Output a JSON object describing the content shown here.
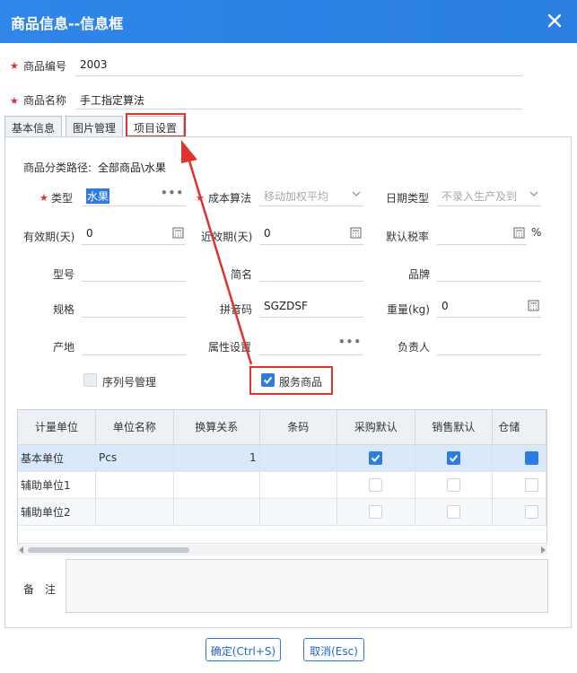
{
  "window": {
    "title": "商品信息--信息框",
    "accent": "#2f86e8"
  },
  "header": {
    "code_label": "商品编号",
    "code_value": "2003",
    "name_label": "商品名称",
    "name_value": "手工指定算法"
  },
  "tabs": [
    "基本信息",
    "图片管理",
    "项目设置"
  ],
  "form": {
    "category_path_label": "商品分类路径:",
    "category_path_value": "全部商品\\水果",
    "type_label": "类型",
    "type_value": "水果",
    "cost_method_label": "成本算法",
    "cost_method_value": "移动加权平均",
    "date_type_label": "日期类型",
    "date_type_value": "不录入生产及到期",
    "shelf_life_label": "有效期(天)",
    "shelf_life_value": "0",
    "near_expiry_label": "近效期(天)",
    "near_expiry_value": "0",
    "tax_label": "默认税率",
    "tax_unit": "%",
    "model_label": "型号",
    "short_name_label": "简名",
    "brand_label": "品牌",
    "spec_label": "规格",
    "pinyin_label": "拼音码",
    "pinyin_value": "SGZDSF",
    "weight_label": "重量(kg)",
    "weight_value": "0",
    "origin_label": "产地",
    "attr_label": "属性设置",
    "owner_label": "负责人",
    "serial_label": "序列号管理",
    "service_label": "服务商品"
  },
  "grid": {
    "headers": [
      "计量单位",
      "单位名称",
      "换算关系",
      "条码",
      "采购默认",
      "销售默认",
      "仓储"
    ],
    "rows": [
      {
        "unit": "基本单位",
        "name": "Pcs",
        "ratio": "1",
        "barcode": "",
        "purchase": true,
        "sale": true
      },
      {
        "unit": "辅助单位1",
        "name": "",
        "ratio": "",
        "barcode": "",
        "purchase": false,
        "sale": false
      },
      {
        "unit": "辅助单位2",
        "name": "",
        "ratio": "",
        "barcode": "",
        "purchase": false,
        "sale": false
      }
    ]
  },
  "remark_label": "备　注",
  "buttons": {
    "ok": "确定(Ctrl+S)",
    "cancel": "取消(Esc)"
  }
}
